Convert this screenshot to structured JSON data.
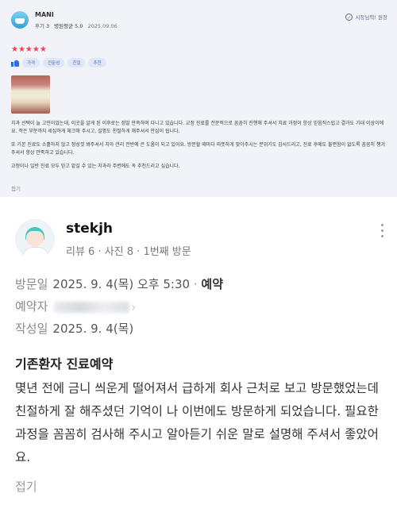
{
  "review1": {
    "username": "MANI",
    "stats": "후기 3",
    "avg_rating": "병원평균 5.0",
    "date": "2025.09.06",
    "owner_badge": "시장님픽! 원장",
    "stars": "★★★★★",
    "tags": [
      "가격",
      "전문성",
      "친절",
      "추천"
    ],
    "paragraphs": [
      "치과 선택이 늘 고민이었는데, 이곳을 알게 된 이후로는 정말 만족하며 다니고 있습니다. 교정 진료를 전문적으로 꼼꼼히 진행해 주셔서 치료 과정이 항상 믿음직스럽고 결과도 기대 이상이에요. 작은 부분까지 세심하게 체크해 주시고, 설명도 친절하게 해주셔서 안심이 됩니다.",
      "또 기본 진료도 소홀하지 않고 정성껏 봐주셔서 치아 관리 전반에 큰 도움이 되고 있어요. 방문할 때마다 따뜻하게 맞아주시는 분위기도 감사드리고, 진료 후에도 불편함이 없도록 꼼꼼히 챙겨주셔서 항상 만족하고 있습니다.",
      "교정이나 일반 진료 모두 믿고 맡길 수 있는 치과라 주변에도 꼭 추천드리고 싶습니다."
    ],
    "collapse": "접기"
  },
  "review2": {
    "username": "stekjh",
    "meta": "리뷰 6 · 사진 8 · 1번째 방문",
    "visit_label": "방문일",
    "visit_value": "2025. 9. 4(목) 오후 5:30",
    "visit_type": "예약",
    "booker_label": "예약자",
    "written_label": "작성일",
    "written_value": "2025. 9. 4(목)",
    "title": "기존환자 진료예약",
    "body": "몇년 전에 금니 씌운게 떨어져서 급하게 회사 근처로 보고 방문했었는데 친절하게 잘 해주셨던 기억이 나 이번에도 방문하게 되었습니다. 필요한 과정을 꼼꼼히 검사해 주시고 알아듣기 쉬운 말로 설명해 주셔서 좋았어요.",
    "collapse": "접기"
  },
  "colors": {
    "star": "#ff3b58",
    "accent_blue": "#2c6fe0",
    "card_bg": "#f1f3f8"
  }
}
